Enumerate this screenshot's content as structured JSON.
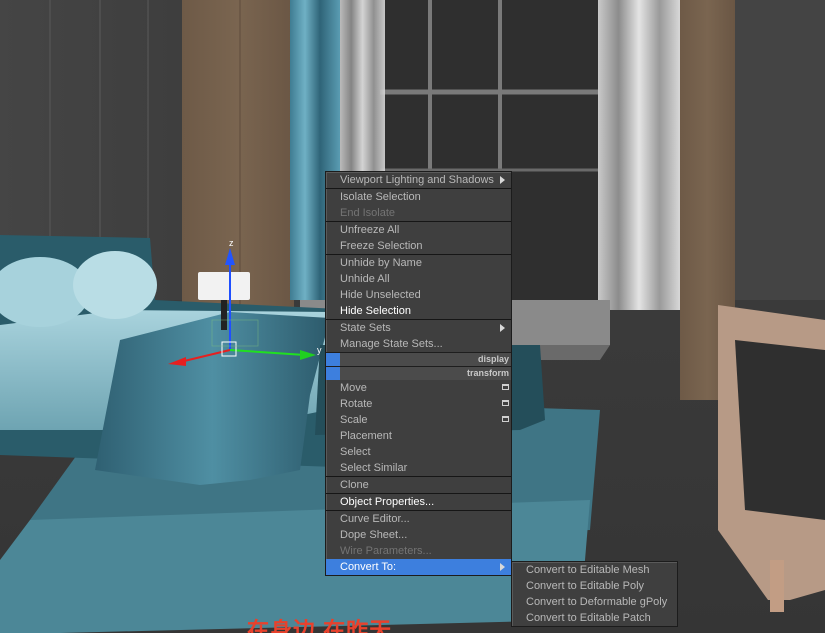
{
  "viewport": {
    "axis_labels": {
      "x": "x",
      "y": "y",
      "z": "z"
    }
  },
  "menu": {
    "items": [
      {
        "label": "Viewport Lighting and Shadows",
        "submenu": true,
        "state": "normal"
      },
      {
        "sep": true
      },
      {
        "label": "Isolate Selection",
        "state": "normal"
      },
      {
        "label": "End Isolate",
        "state": "disabled"
      },
      {
        "sep": true
      },
      {
        "label": "Unfreeze All",
        "state": "normal"
      },
      {
        "label": "Freeze Selection",
        "state": "normal"
      },
      {
        "sep": true
      },
      {
        "label": "Unhide by Name",
        "state": "normal"
      },
      {
        "label": "Unhide All",
        "state": "normal"
      },
      {
        "label": "Hide Unselected",
        "state": "normal"
      },
      {
        "label": "Hide Selection",
        "state": "bright"
      },
      {
        "sep": true
      },
      {
        "label": "State Sets",
        "submenu": true,
        "state": "normal"
      },
      {
        "label": "Manage State Sets...",
        "state": "normal"
      },
      {
        "header": "display"
      },
      {
        "header": "transform"
      },
      {
        "label": "Move",
        "box": true,
        "state": "normal"
      },
      {
        "label": "Rotate",
        "box": true,
        "state": "normal"
      },
      {
        "label": "Scale",
        "box": true,
        "state": "normal"
      },
      {
        "label": "Placement",
        "state": "normal"
      },
      {
        "label": "Select",
        "state": "normal"
      },
      {
        "label": "Select Similar",
        "state": "normal"
      },
      {
        "sep": true
      },
      {
        "label": "Clone",
        "state": "normal"
      },
      {
        "sep": true
      },
      {
        "label": "Object Properties...",
        "state": "bright"
      },
      {
        "sep": true
      },
      {
        "label": "Curve Editor...",
        "state": "normal"
      },
      {
        "label": "Dope Sheet...",
        "state": "normal"
      },
      {
        "label": "Wire Parameters...",
        "state": "disabled"
      },
      {
        "label": "Convert To:",
        "submenu": true,
        "state": "active"
      }
    ]
  },
  "submenu": {
    "items": [
      {
        "label": "Convert to Editable Mesh"
      },
      {
        "label": "Convert to Editable Poly"
      },
      {
        "label": "Convert to Deformable gPoly"
      },
      {
        "label": "Convert to Editable Patch"
      }
    ]
  },
  "subtitle": {
    "text": "在身边 在昨天"
  },
  "colors": {
    "menu_bg": "#3f3f3f",
    "highlight": "#3d7fde",
    "text": "#b8b8b8",
    "text_disabled": "#747474",
    "subtitle": "#e8412c"
  }
}
